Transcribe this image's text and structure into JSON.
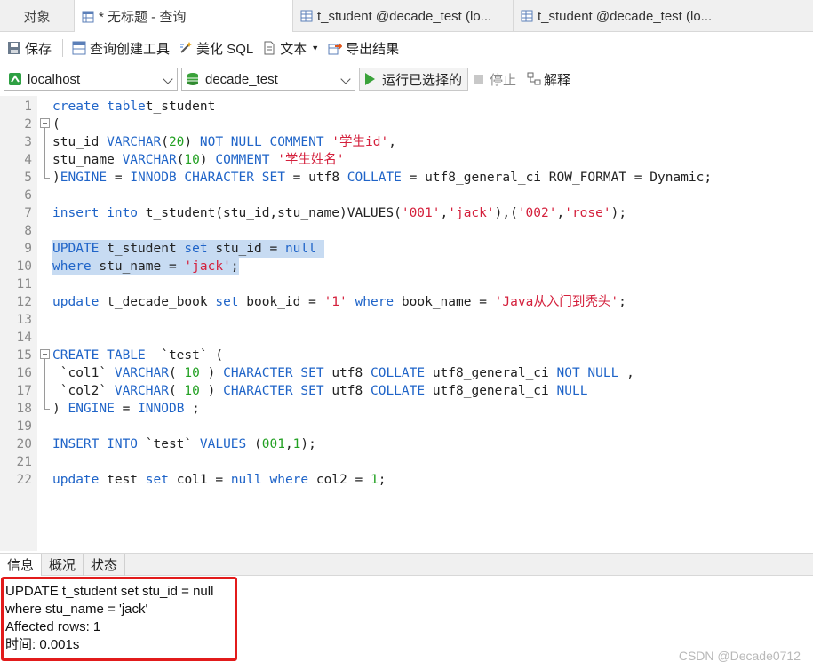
{
  "tabs": {
    "objects": "对象",
    "active": "* 无标题 - 查询",
    "tab1": "t_student @decade_test (lo...",
    "tab2": "t_student @decade_test (lo..."
  },
  "toolbar": {
    "save": "保存",
    "query_builder": "查询创建工具",
    "beautify": "美化 SQL",
    "text": "文本",
    "export": "导出结果"
  },
  "connection": {
    "host": "localhost",
    "database": "decade_test",
    "run_selected": "运行已选择的",
    "stop": "停止",
    "explain": "解释"
  },
  "editor": {
    "line_numbers": [
      "1",
      "2",
      "3",
      "4",
      "5",
      "6",
      "7",
      "8",
      "9",
      "10",
      "11",
      "12",
      "13",
      "14",
      "15",
      "16",
      "17",
      "18",
      "19",
      "20",
      "21",
      "22"
    ],
    "lines": [
      [
        [
          "kw",
          "create table"
        ],
        [
          "",
          "t_student"
        ]
      ],
      [
        [
          "",
          "("
        ]
      ],
      [
        [
          "",
          "stu_id "
        ],
        [
          "kw",
          "VARCHAR"
        ],
        [
          "",
          "("
        ],
        [
          "num",
          "20"
        ],
        [
          "",
          ") "
        ],
        [
          "kw",
          "NOT NULL COMMENT "
        ],
        [
          "str",
          "'学生id'"
        ],
        [
          "",
          ","
        ]
      ],
      [
        [
          "",
          "stu_name "
        ],
        [
          "kw",
          "VARCHAR"
        ],
        [
          "",
          "("
        ],
        [
          "num",
          "10"
        ],
        [
          "",
          ") "
        ],
        [
          "kw",
          "COMMENT "
        ],
        [
          "str",
          "'学生姓名'"
        ]
      ],
      [
        [
          "",
          ")"
        ],
        [
          "kw",
          "ENGINE"
        ],
        [
          "",
          " = "
        ],
        [
          "kw",
          "INNODB CHARACTER SET"
        ],
        [
          "",
          " = utf8 "
        ],
        [
          "kw",
          "COLLATE"
        ],
        [
          "",
          " = utf8_general_ci ROW_FORMAT = Dynamic;"
        ]
      ],
      [],
      [
        [
          "kw",
          "insert into"
        ],
        [
          "",
          " t_student(stu_id,stu_name)VALUES("
        ],
        [
          "str",
          "'001'"
        ],
        [
          "",
          ","
        ],
        [
          "str",
          "'jack'"
        ],
        [
          "",
          "),("
        ],
        [
          "str",
          "'002'"
        ],
        [
          "",
          ","
        ],
        [
          "str",
          "'rose'"
        ],
        [
          "",
          ");"
        ]
      ],
      [],
      [
        [
          "kw",
          "UPDATE"
        ],
        [
          "",
          " t_student "
        ],
        [
          "kw",
          "set"
        ],
        [
          "",
          " stu_id = "
        ],
        [
          "kw",
          "null"
        ]
      ],
      [
        [
          "kw",
          "where"
        ],
        [
          "",
          " stu_name = "
        ],
        [
          "str",
          "'jack'"
        ],
        [
          "",
          ";"
        ]
      ],
      [],
      [
        [
          "kw",
          "update"
        ],
        [
          "",
          " t_decade_book "
        ],
        [
          "kw",
          "set"
        ],
        [
          "",
          " book_id = "
        ],
        [
          "str",
          "'1'"
        ],
        [
          "",
          " "
        ],
        [
          "kw",
          "where"
        ],
        [
          "",
          " book_name = "
        ],
        [
          "str",
          "'Java从入门到秃头'"
        ],
        [
          "",
          ";"
        ]
      ],
      [],
      [],
      [
        [
          "kw",
          "CREATE TABLE"
        ],
        [
          "",
          "  `test` ("
        ]
      ],
      [
        [
          "",
          " `col1` "
        ],
        [
          "kw",
          "VARCHAR"
        ],
        [
          "",
          "( "
        ],
        [
          "num",
          "10"
        ],
        [
          "",
          " ) "
        ],
        [
          "kw",
          "CHARACTER SET"
        ],
        [
          "",
          " utf8 "
        ],
        [
          "kw",
          "COLLATE"
        ],
        [
          "",
          " utf8_general_ci "
        ],
        [
          "kw",
          "NOT NULL"
        ],
        [
          "",
          " ,"
        ]
      ],
      [
        [
          "",
          " `col2` "
        ],
        [
          "kw",
          "VARCHAR"
        ],
        [
          "",
          "( "
        ],
        [
          "num",
          "10"
        ],
        [
          "",
          " ) "
        ],
        [
          "kw",
          "CHARACTER SET"
        ],
        [
          "",
          " utf8 "
        ],
        [
          "kw",
          "COLLATE"
        ],
        [
          "",
          " utf8_general_ci "
        ],
        [
          "kw",
          "NULL"
        ]
      ],
      [
        [
          "",
          ") "
        ],
        [
          "kw",
          "ENGINE"
        ],
        [
          "",
          " = "
        ],
        [
          "kw",
          "INNODB"
        ],
        [
          "",
          " ;"
        ]
      ],
      [],
      [
        [
          "kw",
          "INSERT INTO"
        ],
        [
          "",
          " `test` "
        ],
        [
          "kw",
          "VALUES"
        ],
        [
          "",
          " ("
        ],
        [
          "num",
          "001"
        ],
        [
          "",
          ","
        ],
        [
          "num",
          "1"
        ],
        [
          "",
          ");"
        ]
      ],
      [],
      [
        [
          "kw",
          "update"
        ],
        [
          "",
          " test "
        ],
        [
          "kw",
          "set"
        ],
        [
          "",
          " col1 = "
        ],
        [
          "kw",
          "null"
        ],
        [
          "",
          " "
        ],
        [
          "kw",
          "where"
        ],
        [
          "",
          " col2 = "
        ],
        [
          "num",
          "1"
        ],
        [
          "",
          ";"
        ]
      ]
    ]
  },
  "bottom_tabs": [
    "信息",
    "概况",
    "状态"
  ],
  "info": {
    "line1": "UPDATE t_student set stu_id = null",
    "line2": "where stu_name = 'jack'",
    "line3": "Affected rows: 1",
    "line4": "时间: 0.001s"
  },
  "watermark": "CSDN @Decade0712",
  "colors": {
    "keyword": "#1f64c8",
    "string": "#d4203c",
    "number": "#22a022",
    "selection": "#c7dbf2",
    "highlight_box": "#e21b1b"
  }
}
